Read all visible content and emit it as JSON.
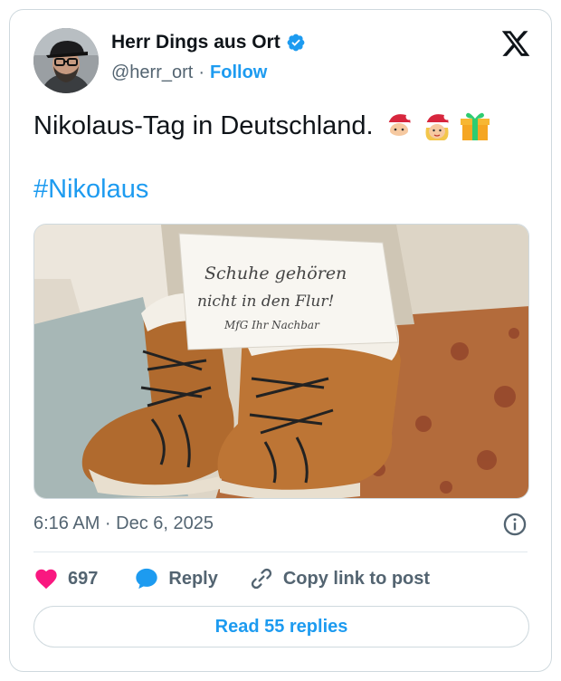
{
  "author": {
    "name": "Herr Dings aus Ort",
    "handle": "@herr_ort",
    "separator": "·",
    "follow_label": "Follow",
    "verified": true
  },
  "tweet": {
    "text": "Nikolaus-Tag in Deutschland.",
    "emojis": [
      "santa-emoji",
      "mrs-claus-emoji",
      "gift-emoji"
    ],
    "hashtag": "#Nikolaus",
    "timestamp": "6:16 AM · Dec 6, 2025"
  },
  "photo": {
    "note_line1": "Schuhe gehören",
    "note_line2": "nicht in den Flur!",
    "note_line3": "MfG   Ihr Nachbar"
  },
  "actions": {
    "like_count": "697",
    "reply_label": "Reply",
    "copy_link_label": "Copy link to post"
  },
  "footer": {
    "read_replies_label": "Read 55 replies"
  },
  "colors": {
    "accent": "#1d9bf0",
    "like": "#f91880",
    "text": "#0f1419",
    "muted": "#536471",
    "border": "#cfd9de"
  }
}
